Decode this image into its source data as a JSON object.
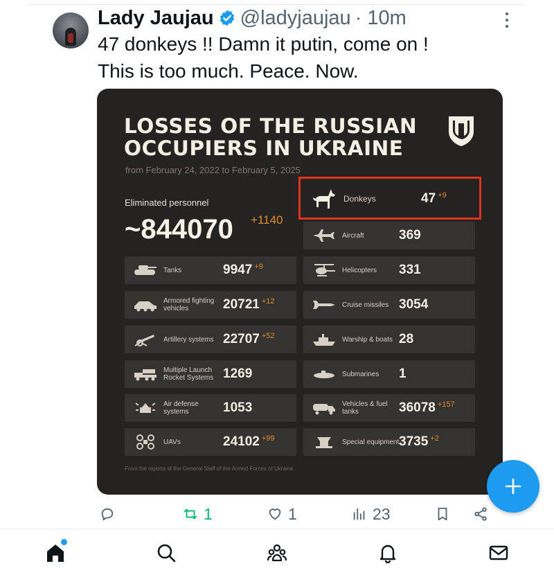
{
  "tweet": {
    "author_name": "Lady Jaujau",
    "handle": "@ladyjaujau",
    "time": "· 10m",
    "text_lines": [
      "47 donkeys !! Damn it putin, come on !",
      "This is too much. Peace. Now."
    ]
  },
  "card": {
    "title_lines": [
      "LOSSES OF THE RUSSIAN",
      "OCCUPIERS IN UKRAINE"
    ],
    "date_range": "from February 24, 2022 to February 5, 2025",
    "personnel_label": "Eliminated personnel",
    "personnel_value": "~844070",
    "personnel_delta": "+1140",
    "left_stats": [
      {
        "label": "Tanks",
        "value": "9947",
        "delta": "+9",
        "icon": "tank-icon"
      },
      {
        "label": "Armored fighting vehicles",
        "value": "20721",
        "delta": "+12",
        "icon": "armored-vehicle-icon"
      },
      {
        "label": "Artillery systems",
        "value": "22707",
        "delta": "+52",
        "icon": "artillery-icon"
      },
      {
        "label": "Multiple Launch Rocket Systems",
        "value": "1269",
        "delta": "",
        "icon": "rocket-launcher-icon"
      },
      {
        "label": "Air defense systems",
        "value": "1053",
        "delta": "",
        "icon": "air-defense-icon"
      },
      {
        "label": "UAVs",
        "value": "24102",
        "delta": "+99",
        "icon": "drone-icon"
      }
    ],
    "right_stats": [
      {
        "label": "Donkeys",
        "value": "47",
        "delta": "+9",
        "icon": "donkey-icon"
      },
      {
        "label": "Aircraft",
        "value": "369",
        "delta": "",
        "icon": "aircraft-icon"
      },
      {
        "label": "Helicopters",
        "value": "331",
        "delta": "",
        "icon": "helicopter-icon"
      },
      {
        "label": "Cruise missiles",
        "value": "3054",
        "delta": "",
        "icon": "missile-icon"
      },
      {
        "label": "Warship & boats",
        "value": "28",
        "delta": "",
        "icon": "warship-icon"
      },
      {
        "label": "Submarines",
        "value": "1",
        "delta": "",
        "icon": "submarine-icon"
      },
      {
        "label": "Vehicles & fuel tanks",
        "value": "36078",
        "delta": "+157",
        "icon": "truck-icon"
      },
      {
        "label": "Special equipment",
        "value": "3735",
        "delta": "+2",
        "icon": "special-equipment-icon"
      }
    ],
    "footer": "From the reports of the General Staff of the Armed Forces of Ukraine",
    "highlight_color": "#e0331f"
  },
  "actions": {
    "reply_count": "",
    "retweet_count": "1",
    "like_count": "1",
    "views_count": "23"
  },
  "colors": {
    "accent": "#1d9bf0",
    "retweet_active": "#00ba7c",
    "delta": "#e38a2c"
  }
}
